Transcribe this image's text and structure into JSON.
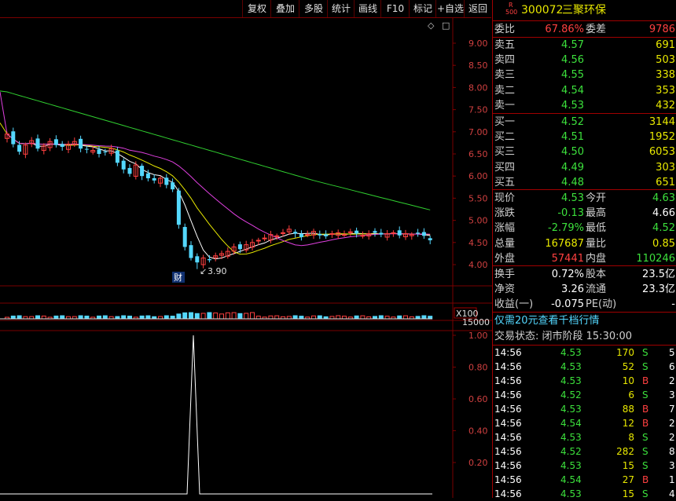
{
  "toolbar": {
    "buttons": [
      "复权",
      "叠加",
      "多股",
      "统计",
      "画线",
      "F10",
      "标记",
      "+自选",
      "返回"
    ]
  },
  "chart": {
    "price_ticks": [
      "9.00",
      "8.50",
      "8.00",
      "7.50",
      "7.00",
      "6.50",
      "6.00",
      "5.50",
      "5.00",
      "4.50",
      "4.00"
    ],
    "volume_tick": "15000",
    "volume_unit": "X100",
    "indicator_ticks": [
      "1.00",
      "0.80",
      "0.60",
      "0.40",
      "0.20"
    ],
    "low_marker": "3.90",
    "event_marker": "财",
    "colors": {
      "up": "#ff4040",
      "down": "#54d8ff",
      "ma5": "#ffffff",
      "ma10": "#e8e800",
      "ma20": "#e040e0",
      "ma60": "#30d030",
      "grid": "#7a0000"
    }
  },
  "quote": {
    "badge_top": "R",
    "badge_bottom": "500",
    "code": "300072",
    "name": "三聚环保",
    "wei_bi_label": "委比",
    "wei_bi": "67.86%",
    "wei_cha_label": "委差",
    "wei_cha": "9786",
    "asks": [
      {
        "label": "卖五",
        "price": "4.57",
        "vol": "691"
      },
      {
        "label": "卖四",
        "price": "4.56",
        "vol": "503"
      },
      {
        "label": "卖三",
        "price": "4.55",
        "vol": "338"
      },
      {
        "label": "卖二",
        "price": "4.54",
        "vol": "353"
      },
      {
        "label": "卖一",
        "price": "4.53",
        "vol": "432"
      }
    ],
    "bids": [
      {
        "label": "买一",
        "price": "4.52",
        "vol": "3144"
      },
      {
        "label": "买二",
        "price": "4.51",
        "vol": "1952"
      },
      {
        "label": "买三",
        "price": "4.50",
        "vol": "6053"
      },
      {
        "label": "买四",
        "price": "4.49",
        "vol": "303"
      },
      {
        "label": "买五",
        "price": "4.48",
        "vol": "651"
      }
    ],
    "stats": [
      {
        "l1": "现价",
        "v1": "4.53",
        "l2": "今开",
        "v2": "4.63"
      },
      {
        "l1": "涨跌",
        "v1": "-0.13",
        "l2": "最高",
        "v2": "4.66"
      },
      {
        "l1": "涨幅",
        "v1": "-2.79%",
        "l2": "最低",
        "v2": "4.52"
      },
      {
        "l1": "总量",
        "v1": "167687",
        "l2": "量比",
        "v2": "0.85"
      },
      {
        "l1": "外盘",
        "v1": "57441",
        "l2": "内盘",
        "v2": "110246"
      }
    ],
    "info": [
      {
        "l1": "换手",
        "v1": "0.72%",
        "l2": "股本",
        "v2": "23.5亿"
      },
      {
        "l1": "净资",
        "v1": "3.26",
        "l2": "流通",
        "v2": "23.3亿"
      },
      {
        "l1": "收益(一)",
        "v1": "-0.075",
        "l2": "PE(动)",
        "v2": "-"
      }
    ],
    "promo": "仅需20元查看千档行情",
    "status": "交易状态: 闭市阶段 15:30:00",
    "ticks": [
      {
        "time": "14:56",
        "price": "4.53",
        "vol": "170",
        "bs": "S",
        "n": "5"
      },
      {
        "time": "14:56",
        "price": "4.53",
        "vol": "52",
        "bs": "S",
        "n": "6"
      },
      {
        "time": "14:56",
        "price": "4.53",
        "vol": "10",
        "bs": "B",
        "n": "2"
      },
      {
        "time": "14:56",
        "price": "4.52",
        "vol": "6",
        "bs": "S",
        "n": "3"
      },
      {
        "time": "14:56",
        "price": "4.53",
        "vol": "88",
        "bs": "B",
        "n": "7"
      },
      {
        "time": "14:56",
        "price": "4.54",
        "vol": "12",
        "bs": "B",
        "n": "2"
      },
      {
        "time": "14:56",
        "price": "4.53",
        "vol": "8",
        "bs": "S",
        "n": "2"
      },
      {
        "time": "14:56",
        "price": "4.52",
        "vol": "282",
        "bs": "S",
        "n": "8"
      },
      {
        "time": "14:56",
        "price": "4.53",
        "vol": "15",
        "bs": "S",
        "n": "3"
      },
      {
        "time": "14:56",
        "price": "4.54",
        "vol": "27",
        "bs": "B",
        "n": "1"
      },
      {
        "time": "14:56",
        "price": "4.53",
        "vol": "15",
        "bs": "S",
        "n": "4"
      }
    ]
  }
}
